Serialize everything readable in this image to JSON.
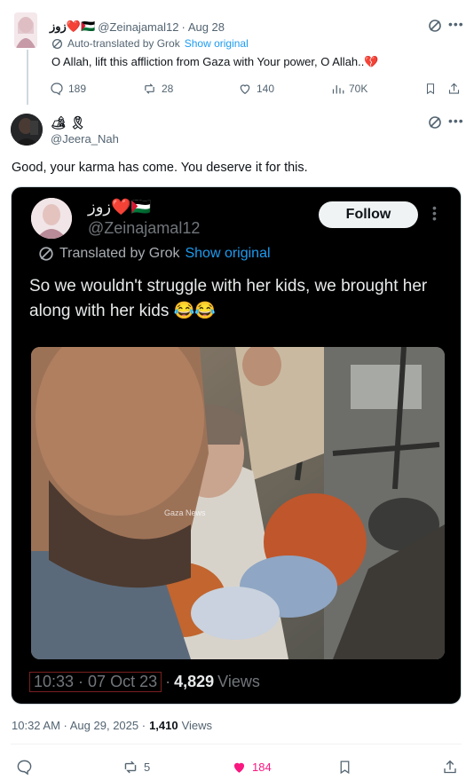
{
  "parent": {
    "display_name": "زوز❤️🇵🇸",
    "handle": "@Zeinajamal12",
    "date": "Aug 28",
    "translated_label": "Auto-translated by Grok",
    "show_original": "Show original",
    "text": "O Allah, lift this affliction from Gaza with Your power, O Allah..💔",
    "replies": "189",
    "reposts": "28",
    "likes": "140",
    "views": "70K"
  },
  "main": {
    "display_name": "🏕 🎗",
    "handle": "@Jeera_Nah",
    "text": "Good, your karma has come. You deserve it for this.",
    "timestamp": "10:32 AM · Aug 29, 2025 ·",
    "views_count": "1,410",
    "views_label": "Views",
    "replies": "",
    "reposts": "5",
    "likes": "184"
  },
  "embedded": {
    "display_name": "زوز❤️🇵🇸",
    "handle": "@Zeinajamal12",
    "follow_label": "Follow",
    "translated_label": "Translated by Grok",
    "show_original": "Show original",
    "text": "So we wouldn't struggle with her kids, we brought her along with her kids 😂😂",
    "time_date": "10:33 · 07 Oct 23",
    "views_count": "4,829",
    "views_label": "Views",
    "image_watermark": "Gaza News"
  },
  "colors": {
    "accent": "#1d9bf0",
    "like_active": "#f91880",
    "muted": "#536471"
  }
}
